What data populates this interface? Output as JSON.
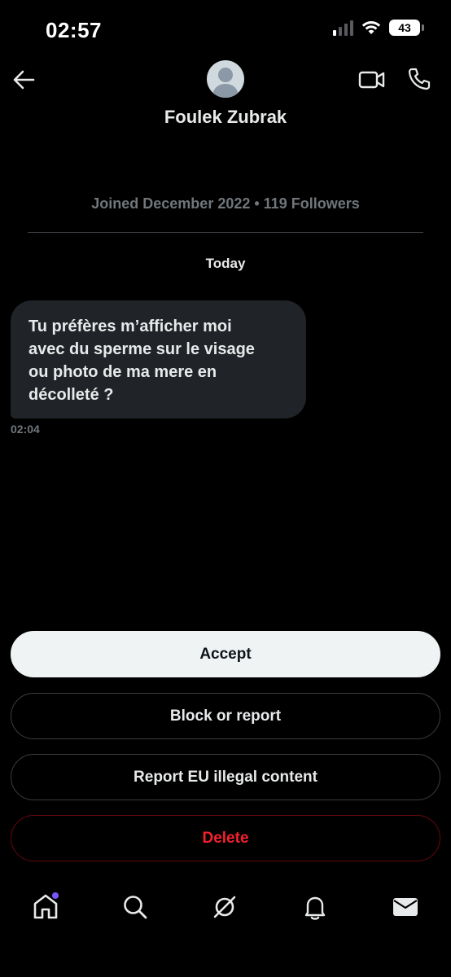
{
  "status_bar": {
    "time": "02:57",
    "battery": "43"
  },
  "header": {
    "contact_name": "Foulek Zubrak"
  },
  "profile": {
    "meta": "Joined December 2022 • 119 Followers"
  },
  "conversation": {
    "day_label": "Today",
    "messages": [
      {
        "lines": [
          "Tu préfères m’afficher moi",
          "avec du sperme sur le visage",
          "ou photo de ma mere en",
          "décolleté ?"
        ],
        "time": "02:04"
      }
    ]
  },
  "actions": {
    "accept": "Accept",
    "block_or_report": "Block or report",
    "report_eu": "Report EU illegal content",
    "delete": "Delete"
  },
  "colors": {
    "background": "#000000",
    "muted_text": "#71767b",
    "bubble": "#202327",
    "accept_bg": "#eff3f4",
    "delete_red": "#f4212e",
    "notification_dot": "#7856ff"
  },
  "icons": {
    "back": "arrow-left-icon",
    "video": "video-camera-icon",
    "phone": "phone-icon",
    "home": "home-icon",
    "search": "search-icon",
    "grok": "grok-icon",
    "notifications": "bell-icon",
    "messages": "envelope-icon"
  }
}
